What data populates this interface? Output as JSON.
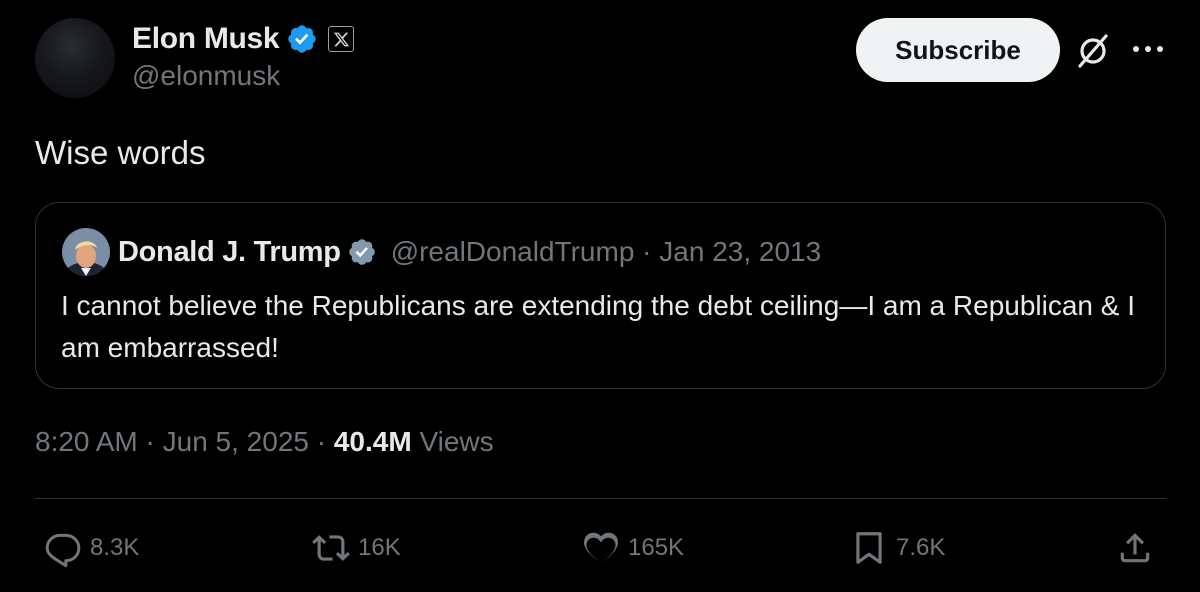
{
  "author": {
    "display_name": "Elon Musk",
    "handle": "@elonmusk"
  },
  "header": {
    "subscribe_label": "Subscribe"
  },
  "tweet": {
    "text": "Wise words",
    "time": "8:20 AM",
    "date": "Jun 5, 2025",
    "views_count": "40.4M",
    "views_label": "Views"
  },
  "quote": {
    "display_name": "Donald J. Trump",
    "handle": "@realDonaldTrump",
    "date": "Jan 23, 2013",
    "text": "I cannot believe the Republicans are extending the debt ceiling—I am a Republican & I am embarrassed!"
  },
  "actions": {
    "replies": "8.3K",
    "reposts": "16K",
    "likes": "165K",
    "bookmarks": "7.6K"
  },
  "colors": {
    "background": "#000000",
    "text": "#e7e9ea",
    "secondary_text": "#71767b",
    "verified_blue": "#1d9bf0",
    "border": "#2f3336",
    "button_bg": "#eff3f4"
  },
  "icons": [
    "verified-badge-icon",
    "x-affiliation-icon",
    "grok-icon",
    "more-icon",
    "reply-icon",
    "repost-icon",
    "like-icon",
    "bookmark-icon",
    "share-icon"
  ]
}
